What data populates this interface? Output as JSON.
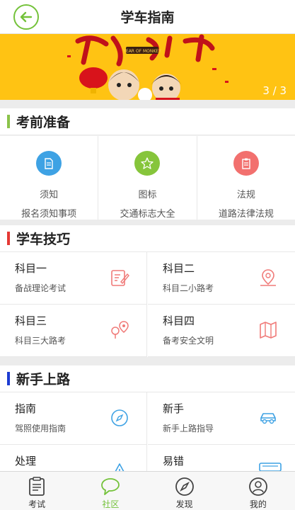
{
  "header": {
    "title": "学车指南",
    "back_icon": "back-arrow-icon"
  },
  "banner": {
    "counter": "3 / 3",
    "text": "YEAR OF MONKEY"
  },
  "sections": {
    "prep": {
      "title": "考前准备",
      "bar_color": "#8bc34a",
      "items": [
        {
          "name": "须知",
          "desc": "报名须知事项",
          "color": "#3ea2e4",
          "icon": "document-icon"
        },
        {
          "name": "图标",
          "desc": "交通标志大全",
          "color": "#86c53b",
          "icon": "star-icon"
        },
        {
          "name": "法规",
          "desc": "道路法律法规",
          "color": "#f2706e",
          "icon": "clipboard-icon"
        }
      ]
    },
    "skills": {
      "title": "学车技巧",
      "bar_color": "#e53935",
      "items": [
        {
          "title": "科目一",
          "sub": "备战理论考试",
          "icon": "edit-note-icon"
        },
        {
          "title": "科目二",
          "sub": "科目二小路考",
          "icon": "location-pin-icon"
        },
        {
          "title": "科目三",
          "sub": "科目三大路考",
          "icon": "route-pins-icon"
        },
        {
          "title": "科目四",
          "sub": "备考安全文明",
          "icon": "map-icon"
        }
      ]
    },
    "newbie": {
      "title": "新手上路",
      "bar_color": "#1e3cd2",
      "items": [
        {
          "title": "指南",
          "sub": "驾照使用指南",
          "icon": "compass-icon"
        },
        {
          "title": "新手",
          "sub": "新手上路指导",
          "icon": "car-icon"
        },
        {
          "title": "处理",
          "sub": "",
          "icon": "warning-icon"
        },
        {
          "title": "易错",
          "sub": "",
          "icon": "bus-icon"
        }
      ]
    }
  },
  "tabbar": {
    "active_color": "#74c23a",
    "tabs": [
      {
        "label": "考试",
        "icon": "exam-icon"
      },
      {
        "label": "社区",
        "icon": "chat-bubble-icon",
        "active": true
      },
      {
        "label": "发现",
        "icon": "compass-icon"
      },
      {
        "label": "我的",
        "icon": "user-icon"
      }
    ]
  }
}
